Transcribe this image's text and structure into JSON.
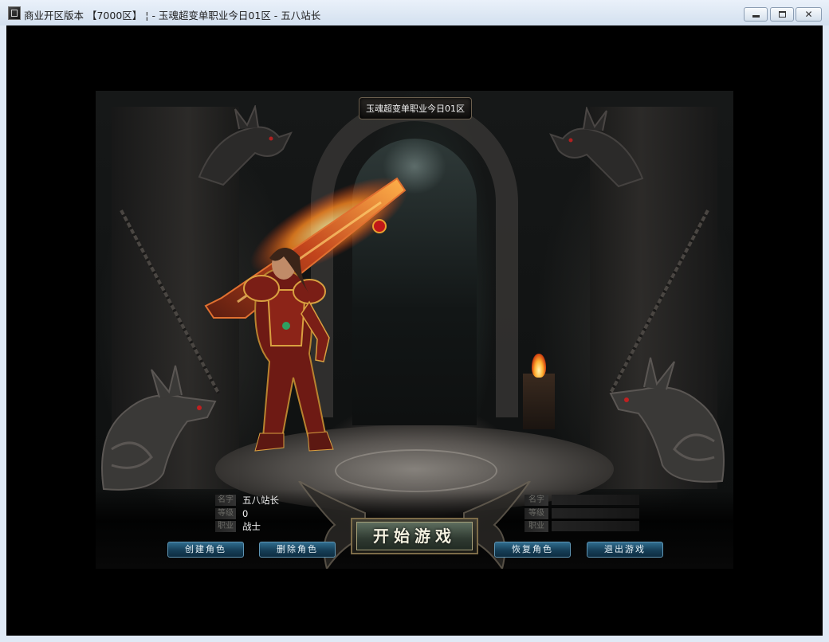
{
  "window": {
    "title": "商业开区版本 【7000区】 ¦ - 玉魂超变单职业今日01区 - 五八站长",
    "min_glyph": "",
    "max_glyph": "",
    "close_glyph": "✕"
  },
  "game": {
    "server_title": "玉魂超变单职业今日01区",
    "start_button": "开始游戏",
    "buttons": {
      "create": "创建角色",
      "delete": "删除角色",
      "restore": "恢复角色",
      "exit": "退出游戏"
    },
    "left_slot": {
      "name_label": "名字",
      "level_label": "等级",
      "class_label": "职业",
      "name_value": "五八站长",
      "level_value": "0",
      "class_value": "战士"
    },
    "right_slot": {
      "name_label": "名字",
      "level_label": "等级",
      "class_label": "职业",
      "name_value": "",
      "level_value": "",
      "class_value": ""
    }
  },
  "icons": {
    "app": "app-icon",
    "minimize": "minimize-icon",
    "maximize": "maximize-icon",
    "close": "close-icon"
  }
}
